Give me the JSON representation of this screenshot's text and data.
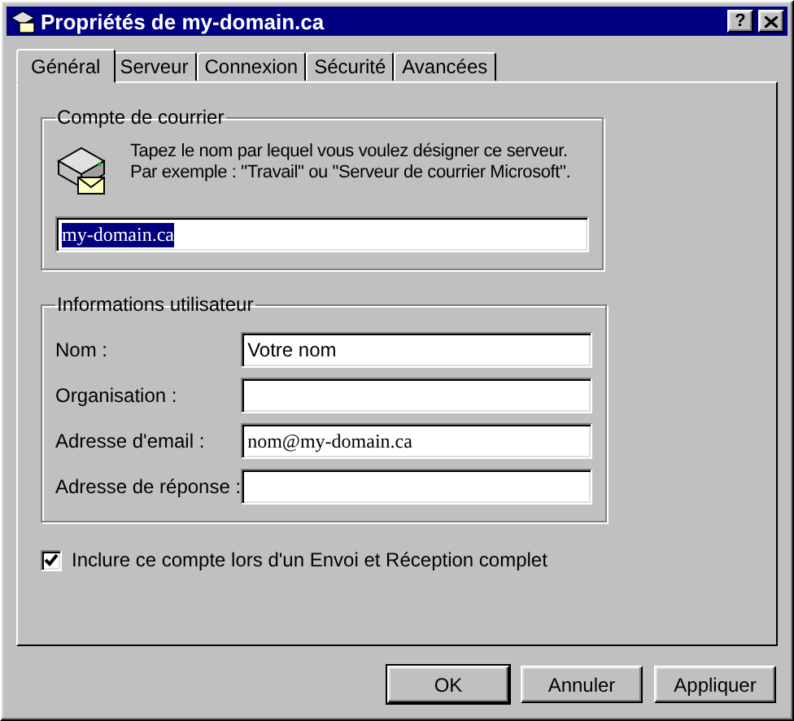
{
  "window": {
    "title": "Propriétés de my-domain.ca",
    "help_button": "?"
  },
  "tabs": [
    {
      "label": "Général",
      "selected": true
    },
    {
      "label": "Serveur",
      "selected": false
    },
    {
      "label": "Connexion",
      "selected": false
    },
    {
      "label": "Sécurité",
      "selected": false
    },
    {
      "label": "Avancées",
      "selected": false
    }
  ],
  "account_group": {
    "title": "Compte de courrier",
    "description": [
      "Tapez le nom par lequel vous voulez désigner ce serveur.",
      "Par exemple : \"Travail\" ou \"Serveur de courrier Microsoft\"."
    ],
    "field": {
      "value": "my-domain.ca",
      "text_selected": true,
      "monospace": true
    }
  },
  "user_group": {
    "title": "Informations utilisateur",
    "fields": [
      {
        "label": "Nom :",
        "value": "Votre nom",
        "monospace": false
      },
      {
        "label": "Organisation :"
      },
      {
        "label": "Adresse d'email :",
        "value": "nom@my-domain.ca",
        "monospace": true
      },
      {
        "label": "Adresse de réponse :"
      }
    ]
  },
  "include_checkbox": {
    "label": "Inclure ce compte lors d'un Envoi et Réception complet",
    "checked": true
  },
  "buttons": [
    {
      "label": "OK",
      "default": true
    },
    {
      "label": "Annuler",
      "default": false
    },
    {
      "label": "Appliquer",
      "default": false
    }
  ]
}
